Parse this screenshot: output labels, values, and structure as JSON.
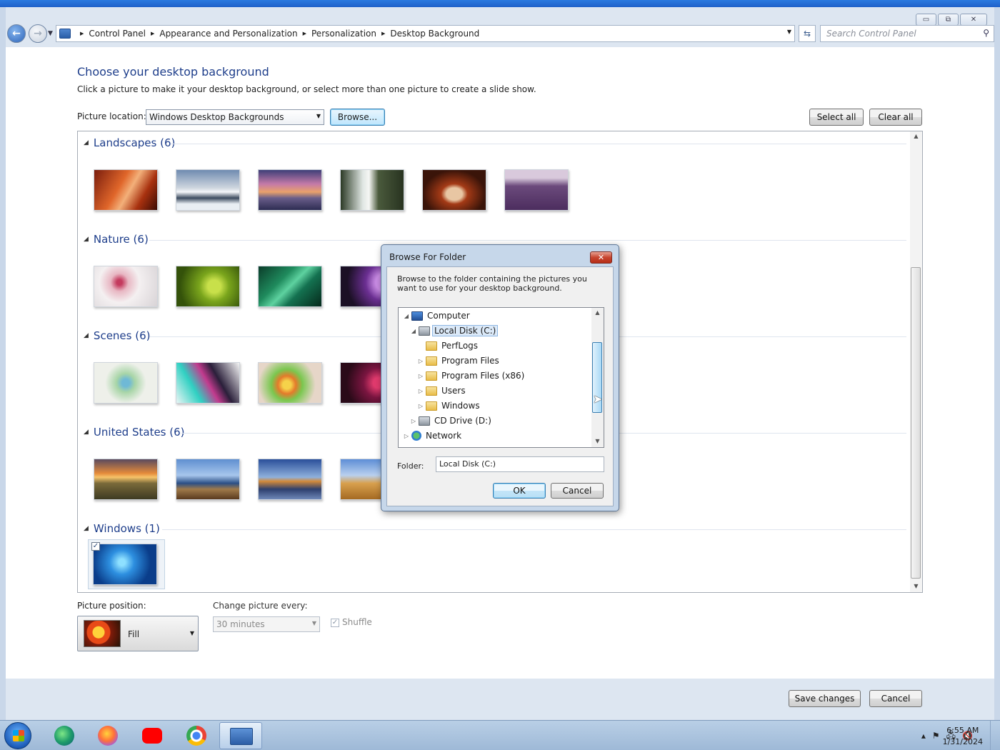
{
  "window": {
    "caption_buttons": {
      "minimize": "▭",
      "maximize": "⧉",
      "close": "✕"
    }
  },
  "nav": {
    "breadcrumbs": [
      "Control Panel",
      "Appearance and Personalization",
      "Personalization",
      "Desktop Background"
    ],
    "search_placeholder": "Search Control Panel"
  },
  "main": {
    "heading": "Choose your desktop background",
    "subtext": "Click a picture to make it your desktop background, or select more than one picture to create a slide show.",
    "picture_location_label": "Picture location:",
    "picture_location_value": "Windows Desktop Backgrounds",
    "browse_label": "Browse...",
    "select_all_label": "Select all",
    "clear_all_label": "Clear all",
    "groups": [
      {
        "title": "Landscapes (6)",
        "thumbs": 6
      },
      {
        "title": "Nature (6)",
        "thumbs": 4
      },
      {
        "title": "Scenes (6)",
        "thumbs": 4
      },
      {
        "title": "United States (6)",
        "thumbs": 4
      },
      {
        "title": "Windows (1)",
        "thumbs": 1,
        "checked": true
      }
    ],
    "picture_position_label": "Picture position:",
    "picture_position_value": "Fill",
    "change_picture_label": "Change picture every:",
    "change_picture_value": "30 minutes",
    "shuffle_label": "Shuffle",
    "shuffle_checked": true,
    "save_label": "Save changes",
    "cancel_label": "Cancel"
  },
  "dialog": {
    "title": "Browse For Folder",
    "close_label": "✕",
    "description": "Browse to the folder containing the pictures you want to use for your desktop background.",
    "tree": [
      {
        "label": "Computer",
        "icon": "computer-icon",
        "expander": "◢"
      },
      {
        "label": "Local Disk (C:)",
        "icon": "disk-icon",
        "expander": "◢",
        "selected": true
      },
      {
        "label": "PerfLogs",
        "icon": "folder-icon",
        "expander": ""
      },
      {
        "label": "Program Files",
        "icon": "folder-icon",
        "expander": "▷"
      },
      {
        "label": "Program Files (x86)",
        "icon": "folder-icon",
        "expander": "▷"
      },
      {
        "label": "Users",
        "icon": "folder-icon",
        "expander": "▷"
      },
      {
        "label": "Windows",
        "icon": "folder-icon",
        "expander": "▷"
      },
      {
        "label": "CD Drive (D:)",
        "icon": "cd-drive-icon",
        "expander": "▷"
      },
      {
        "label": "Network",
        "icon": "network-icon",
        "expander": "▷"
      }
    ],
    "folder_label": "Folder:",
    "folder_value": "Local Disk (C:)",
    "ok_label": "OK",
    "cancel_label": "Cancel"
  },
  "taskbar": {
    "apps": [
      "edge-icon",
      "firefox-icon",
      "youtube-icon",
      "chrome-icon",
      "control-panel-icon"
    ],
    "clock_time": "6:55 AM",
    "clock_date": "1/31/2024"
  }
}
